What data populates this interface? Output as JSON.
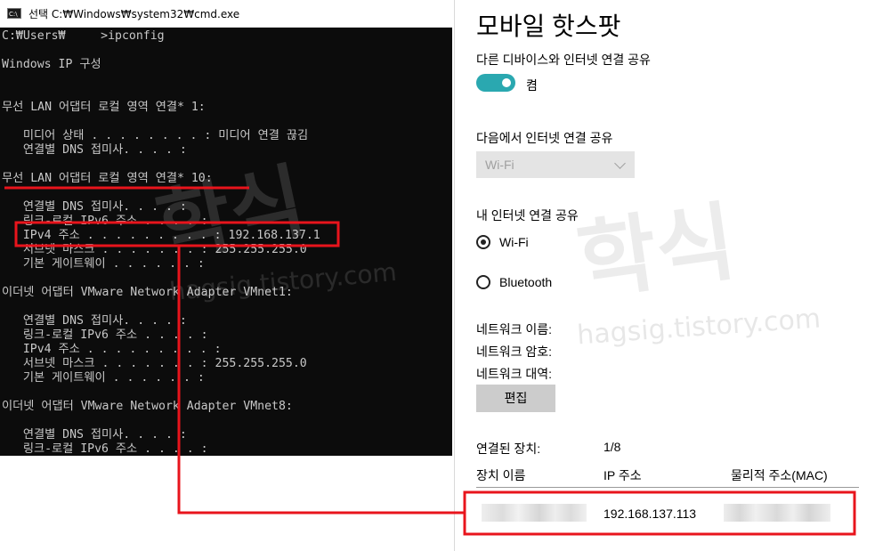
{
  "cmd": {
    "title": "선택 C:₩Windows₩system32₩cmd.exe",
    "lines": [
      "C:₩Users₩     >ipconfig",
      "",
      "Windows IP 구성",
      "",
      "",
      "무선 LAN 어댑터 로컬 영역 연결* 1:",
      "",
      "   미디어 상태 . . . . . . . . : 미디어 연결 끊김",
      "   연결별 DNS 접미사. . . . :",
      "",
      "무선 LAN 어댑터 로컬 영역 연결* 10:",
      "",
      "   연결별 DNS 접미사. . . . :",
      "   링크-로컬 IPv6 주소 . . . . :",
      "   IPv4 주소 . . . . . . . . . : 192.168.137.1",
      "   서브넷 마스크 . . . . . . . : 255.255.255.0",
      "   기본 게이트웨이 . . . . . . :",
      "",
      "이더넷 어댑터 VMware Network Adapter VMnet1:",
      "",
      "   연결별 DNS 접미사. . . . :",
      "   링크-로컬 IPv6 주소 . . . . :",
      "   IPv4 주소 . . . . . . . . . :",
      "   서브넷 마스크 . . . . . . . : 255.255.255.0",
      "   기본 게이트웨이 . . . . . . :",
      "",
      "이더넷 어댑터 VMware Network Adapter VMnet8:",
      "",
      "   연결별 DNS 접미사. . . . :",
      "   링크-로컬 IPv6 주소 . . . . :"
    ]
  },
  "hotspot": {
    "title": "모바일 핫스팟",
    "share_label": "다른 디바이스와 인터넷 연결 공유",
    "toggle_state": "켬",
    "toggle_on": true,
    "share_from_label": "다음에서 인터넷 연결 공유",
    "share_from_value": "Wi-Fi",
    "share_over_label": "내 인터넷 연결 공유",
    "options": [
      "Wi-Fi",
      "Bluetooth"
    ],
    "selected_option": "Wi-Fi",
    "network_name_label": "네트워크 이름:",
    "network_password_label": "네트워크 암호:",
    "network_band_label": "네트워크 대역:",
    "edit_button": "편집",
    "connected_label": "연결된 장치:",
    "connected_count": "1/8",
    "columns": [
      "장치 이름",
      "IP 주소",
      "물리적 주소(MAC)"
    ],
    "device": {
      "ip": "192.168.137.113"
    }
  },
  "watermark": {
    "text": "학식",
    "sub": "hagsig.tistory.com"
  },
  "colors": {
    "accent": "#2aa8b0",
    "highlight": "#e8141c"
  }
}
